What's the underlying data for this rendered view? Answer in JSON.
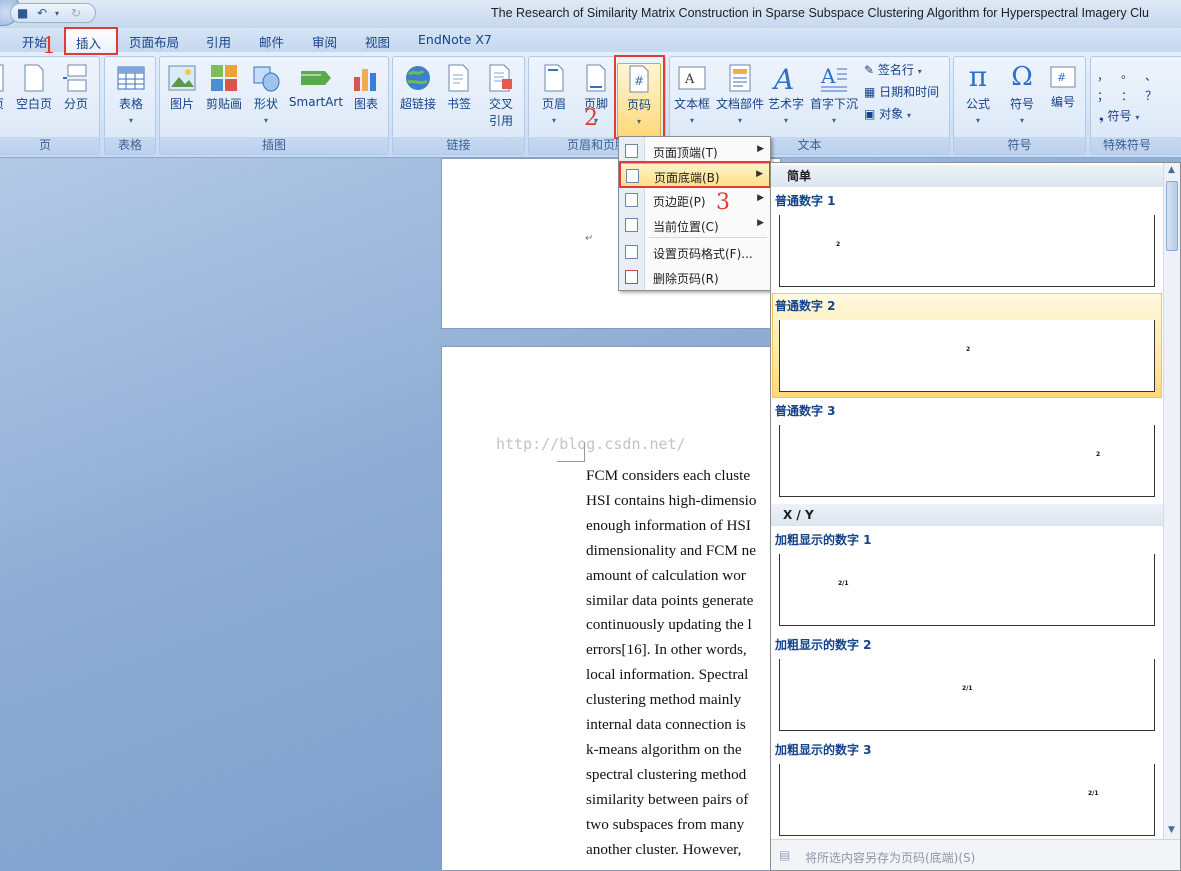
{
  "window": {
    "title": "The Research of Similarity Matrix Construction in Sparse Subspace Clustering Algorithm for Hyperspectral Imagery Clu"
  },
  "tabs": [
    "开始",
    "插入",
    "页面布局",
    "引用",
    "邮件",
    "审阅",
    "视图",
    "EndNote X7"
  ],
  "ribbon": {
    "groups": {
      "pages": {
        "label": "页",
        "buttons": [
          "页",
          "空白页",
          "分页"
        ]
      },
      "table": {
        "label": "表格",
        "buttons": [
          "表格"
        ]
      },
      "illustrations": {
        "label": "插图",
        "buttons": [
          "图片",
          "剪贴画",
          "形状",
          "SmartArt",
          "图表"
        ]
      },
      "links": {
        "label": "链接",
        "buttons": [
          "超链接",
          "书签",
          "交叉",
          "引用"
        ]
      },
      "header_footer": {
        "label": "页眉和页脚",
        "buttons": [
          "页眉",
          "页脚",
          "页码"
        ]
      },
      "text": {
        "label": "文本",
        "buttons": [
          "文本框",
          "文档部件",
          "艺术字",
          "首字下沉"
        ],
        "small": [
          "签名行",
          "日期和时间",
          "对象"
        ]
      },
      "symbols": {
        "label": "符号",
        "buttons": [
          "公式",
          "符号",
          "编号"
        ]
      },
      "special": {
        "label": "特殊符号",
        "symbol_label": "符号",
        "chars": [
          "，",
          "。",
          "、",
          "；",
          "：",
          "？"
        ]
      }
    }
  },
  "annotations": [
    "1",
    "2",
    "3"
  ],
  "page_number_menu": {
    "items": [
      "页面顶端(T)",
      "页面底端(B)",
      "页边距(P)",
      "当前位置(C)",
      "设置页码格式(F)...",
      "删除页码(R)"
    ]
  },
  "gallery": {
    "sections": [
      {
        "header": "简单",
        "items": [
          {
            "name": "普通数字 1",
            "sample": "2"
          },
          {
            "name": "普通数字 2",
            "sample": "2"
          },
          {
            "name": "普通数字 3",
            "sample": "2"
          }
        ]
      },
      {
        "header": "X / Y",
        "items": [
          {
            "name": "加粗显示的数字 1",
            "sample": "2/1"
          },
          {
            "name": "加粗显示的数字 2",
            "sample": "2/1"
          },
          {
            "name": "加粗显示的数字 3",
            "sample": "2/1"
          }
        ]
      }
    ],
    "footer": "将所选内容另存为页码(底端)(S)"
  },
  "document": {
    "watermark": "http://blog.csdn.net/",
    "return_mark": "↵",
    "lines": [
      "FCM considers each cluste",
      "HSI contains high-dimensio",
      "enough information of HSI",
      "dimensionality and FCM ne",
      "amount of calculation wor",
      "similar data points generate",
      "continuously updating the l",
      "errors[16]. In other words,",
      "local information. Spectral",
      "clustering method mainly",
      "internal data connection is",
      "k-means algorithm on the",
      "spectral clustering method",
      "similarity between pairs of",
      "two subspaces from many",
      "another cluster. However,"
    ]
  },
  "colors": {
    "accent": "#15428b",
    "highlight": "#e53935",
    "hover": "#ffe08a"
  }
}
